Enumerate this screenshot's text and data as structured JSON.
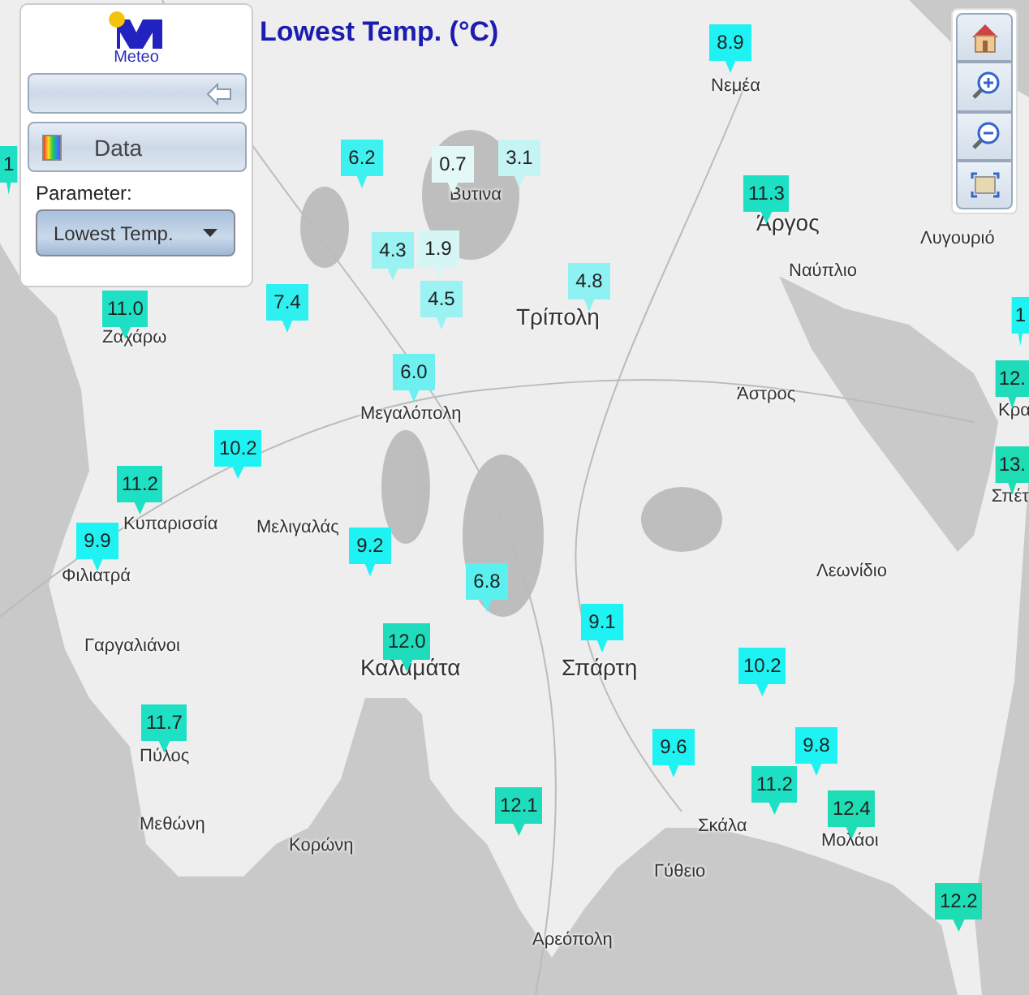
{
  "title": "Lowest Temp. (°C)",
  "logo": {
    "text": "Meteo"
  },
  "panel": {
    "data_button": "Data",
    "parameter_label": "Parameter:",
    "parameter_select": "Lowest Temp."
  },
  "map": {
    "places": [
      "Νεμέα",
      "Βυτινα",
      "Άργος",
      "Λυγουριό",
      "Ναύπλιο",
      "Τρίπολη",
      "Ζαχάρω",
      "Μεγαλόπολη",
      "Άστρος",
      "Κρα",
      "Σπέτ",
      "Κυπαρισσία",
      "Μελιγαλάς",
      "Φιλιατρά",
      "Λεωνίδιο",
      "Σπάρτη",
      "Γαργαλιάνοι",
      "Καλαμάτα",
      "Πύλος",
      "Σκάλα",
      "Μολάοι",
      "Μεθώνη",
      "Κορώνη",
      "Γύθειο",
      "Αρεόπολη"
    ],
    "markers": [
      {
        "value": "8.9",
        "color": "#1ef2f2"
      },
      {
        "value": "6.2",
        "color": "#3ef0f0"
      },
      {
        "value": "0.7",
        "color": "#e4f8f8"
      },
      {
        "value": "3.1",
        "color": "#c4f4f4"
      },
      {
        "value": "11.3",
        "color": "#1ee0c4"
      },
      {
        "value": "4.3",
        "color": "#9af2f2"
      },
      {
        "value": "1.9",
        "color": "#d6f6f6"
      },
      {
        "value": "4.5",
        "color": "#9af2f2"
      },
      {
        "value": "4.8",
        "color": "#8ef2f2"
      },
      {
        "value": "11.0",
        "color": "#1ee0c4"
      },
      {
        "value": "7.4",
        "color": "#2ef0f0"
      },
      {
        "value": "6.0",
        "color": "#6ef0f0"
      },
      {
        "value": "10.2",
        "color": "#1ef2f2"
      },
      {
        "value": "11.2",
        "color": "#1ee0c4"
      },
      {
        "value": "9.9",
        "color": "#1ef2f2"
      },
      {
        "value": "9.2",
        "color": "#1ef2f2"
      },
      {
        "value": "6.8",
        "color": "#5af0f0"
      },
      {
        "value": "12.0",
        "color": "#1edcbc"
      },
      {
        "value": "9.1",
        "color": "#1ef2f2"
      },
      {
        "value": "10.2",
        "color": "#1ef2f2"
      },
      {
        "value": "11.7",
        "color": "#1ee0c4"
      },
      {
        "value": "9.6",
        "color": "#1ef2f2"
      },
      {
        "value": "9.8",
        "color": "#1ef2f2"
      },
      {
        "value": "11.2",
        "color": "#1ee0c4"
      },
      {
        "value": "12.4",
        "color": "#1edcb4"
      },
      {
        "value": "12.1",
        "color": "#1edcbc"
      },
      {
        "value": "12.2",
        "color": "#1edcb4"
      },
      {
        "value": "1",
        "color": "#1ee0c4"
      },
      {
        "value": "1",
        "color": "#1ef2f2"
      },
      {
        "value": "12.",
        "color": "#1edcbc"
      },
      {
        "value": "13.",
        "color": "#1edcb4"
      }
    ]
  }
}
